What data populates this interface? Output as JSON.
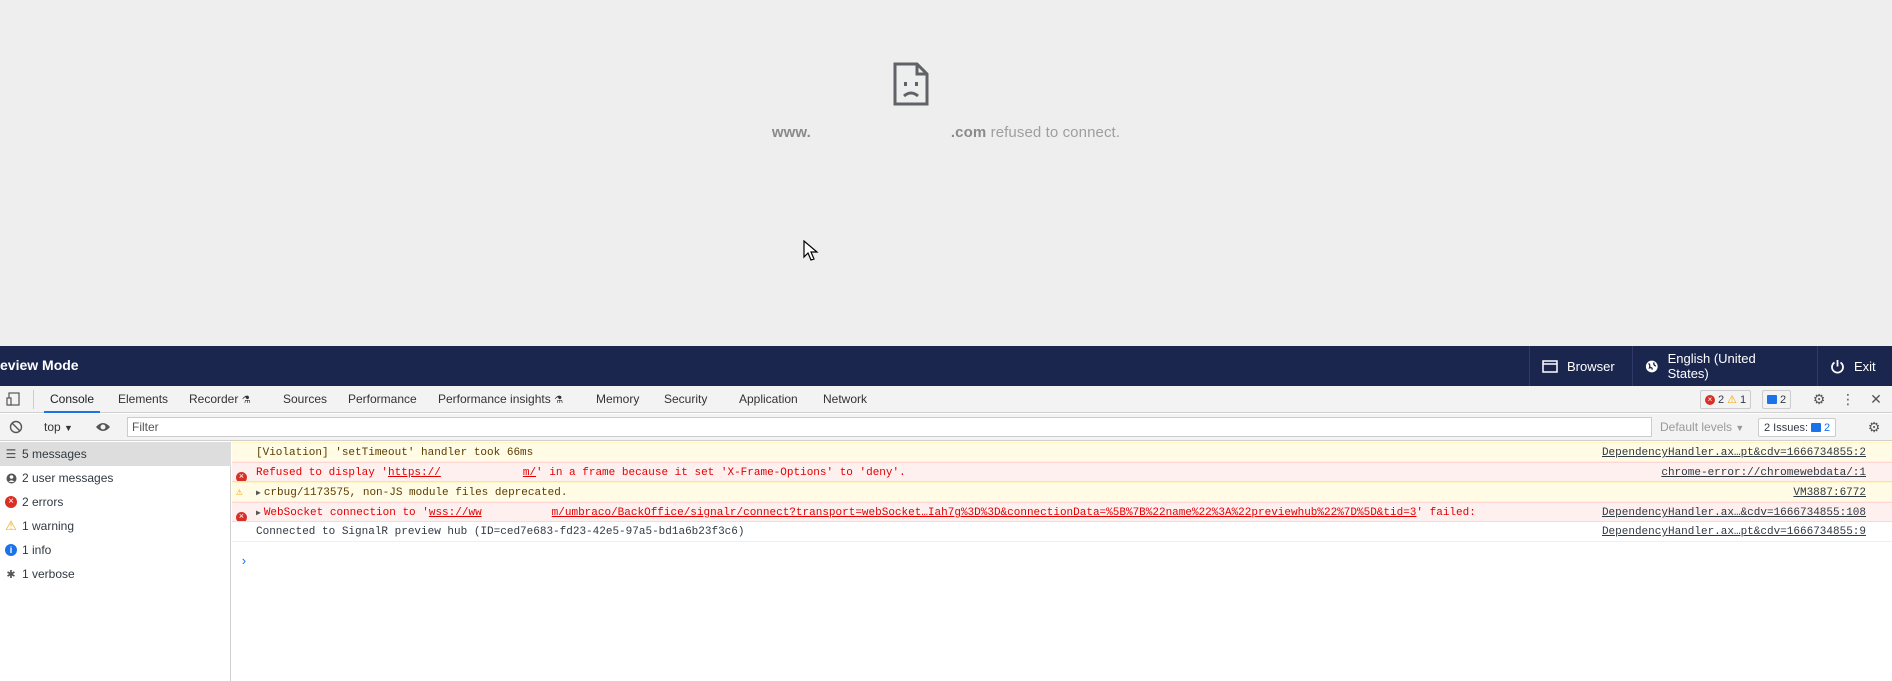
{
  "page": {
    "refused_prefix": "www.",
    "refused_domain_suffix": ".com",
    "refused_text": "refused to connect."
  },
  "preview_bar": {
    "title": "eview Mode",
    "browser_label": "Browser",
    "language_label": "English (United States)",
    "exit_label": "Exit"
  },
  "devtools": {
    "tabs": [
      {
        "label": "Console"
      },
      {
        "label": "Elements"
      },
      {
        "label": "Recorder"
      },
      {
        "label": "Sources"
      },
      {
        "label": "Performance"
      },
      {
        "label": "Performance insights"
      },
      {
        "label": "Memory"
      },
      {
        "label": "Security"
      },
      {
        "label": "Application"
      },
      {
        "label": "Network"
      }
    ],
    "counts": {
      "errors": "2",
      "warnings": "1",
      "issues": "2"
    },
    "filterbar": {
      "context": "top",
      "filter_placeholder": "Filter",
      "levels": "Default levels",
      "issues_label": "2 Issues:",
      "issues_count": "2"
    },
    "sidebar": [
      {
        "label": "5 messages",
        "icon": "list-icon"
      },
      {
        "label": "2 user messages",
        "icon": "user-icon"
      },
      {
        "label": "2 errors",
        "icon": "error-icon"
      },
      {
        "label": "1 warning",
        "icon": "warning-icon"
      },
      {
        "label": "1 info",
        "icon": "info-icon"
      },
      {
        "label": "1 verbose",
        "icon": "bug-icon"
      }
    ],
    "messages": [
      {
        "text": "[Violation] 'setTimeout' handler took 66ms",
        "source": "DependencyHandler.ax…pt&cdv=1666734855:2"
      },
      {
        "text_before": "Refused to display '",
        "link_a": "https://",
        "link_b": "m/",
        "text_after": "' in a frame because it set 'X-Frame-Options' to 'deny'.",
        "source": "chrome-error://chromewebdata/:1"
      },
      {
        "text": "crbug/1173575, non-JS module files deprecated.",
        "source": "VM3887:6772"
      },
      {
        "text_before": "WebSocket connection to '",
        "link_a": "wss://ww",
        "link_b": "m/umbraco/BackOffice/signalr/connect?transport=webSocket…Iah7g%3D%3D&connectionData=%5B%7B%22name%22%3A%22previewhub%22%7D%5D&tid=3",
        "text_after": "' failed:",
        "source": "DependencyHandler.ax…&cdv=1666734855:108"
      },
      {
        "text": "Connected to SignalR preview hub (ID=ced7e683-fd23-42e5-97a5-bd1a6b23f3c6)",
        "source": "DependencyHandler.ax…pt&cdv=1666734855:9"
      }
    ],
    "prompt": "›"
  }
}
